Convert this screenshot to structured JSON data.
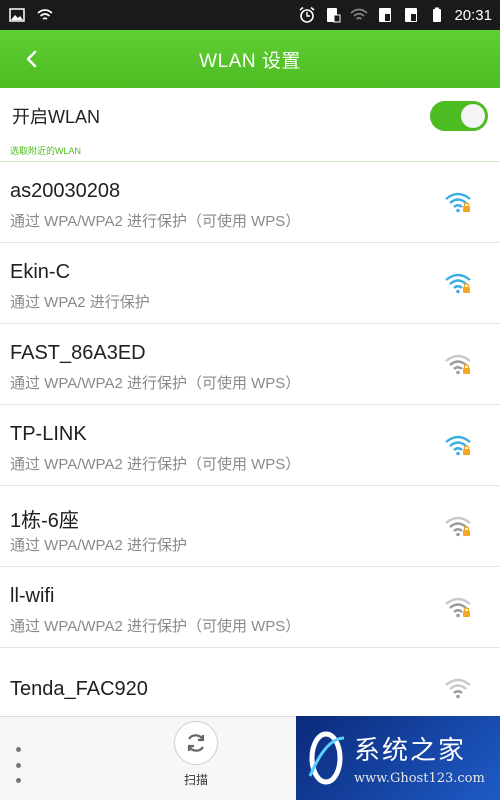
{
  "status_bar": {
    "time": "20:31",
    "icons": [
      "picture-icon",
      "wifi-status-icon",
      "alarm-icon",
      "sim-card-icon",
      "wifi-signal-icon",
      "sim1-icon",
      "sim2-icon",
      "battery-icon"
    ]
  },
  "header": {
    "title": "WLAN 设置",
    "back_icon": "back-arrow-icon"
  },
  "wlan_toggle": {
    "label": "开启WLAN",
    "state": "on"
  },
  "section_label": "选取附近的WLAN",
  "networks": [
    {
      "ssid": "as20030208",
      "security": "通过 WPA/WPA2 进行保护（可使用 WPS）",
      "locked": true,
      "strength": "strong",
      "color": "#3aaee0"
    },
    {
      "ssid": "Ekin-C",
      "security": "通过 WPA2 进行保护",
      "locked": true,
      "strength": "strong",
      "color": "#3aaee0"
    },
    {
      "ssid": "FAST_86A3ED",
      "security": "通过 WPA/WPA2 进行保护（可使用 WPS）",
      "locked": true,
      "strength": "medium",
      "color": "#9a9a9a"
    },
    {
      "ssid": "TP-LINK",
      "security": "通过 WPA/WPA2 进行保护（可使用 WPS）",
      "locked": true,
      "strength": "strong",
      "color": "#3aaee0"
    },
    {
      "ssid": "1栋-6座",
      "security": "通过 WPA/WPA2 进行保护",
      "locked": true,
      "strength": "medium",
      "color": "#9a9a9a"
    },
    {
      "ssid": "ll-wifi",
      "security": "通过 WPA/WPA2 进行保护（可使用 WPS）",
      "locked": true,
      "strength": "medium",
      "color": "#9a9a9a"
    },
    {
      "ssid": "Tenda_FAC920",
      "security": "",
      "locked": false,
      "strength": "weak",
      "color": "#9a9a9a"
    }
  ],
  "bottom_bar": {
    "menu_icon": "more-options-icon",
    "scan_label": "扫描",
    "scan_icon": "refresh-icon"
  },
  "watermark": {
    "title": "系统之家",
    "url": "www.Ghost123.com"
  },
  "colors": {
    "accent": "#4cbc22",
    "wifi_active": "#3aaee0",
    "lock": "#f5a623"
  }
}
